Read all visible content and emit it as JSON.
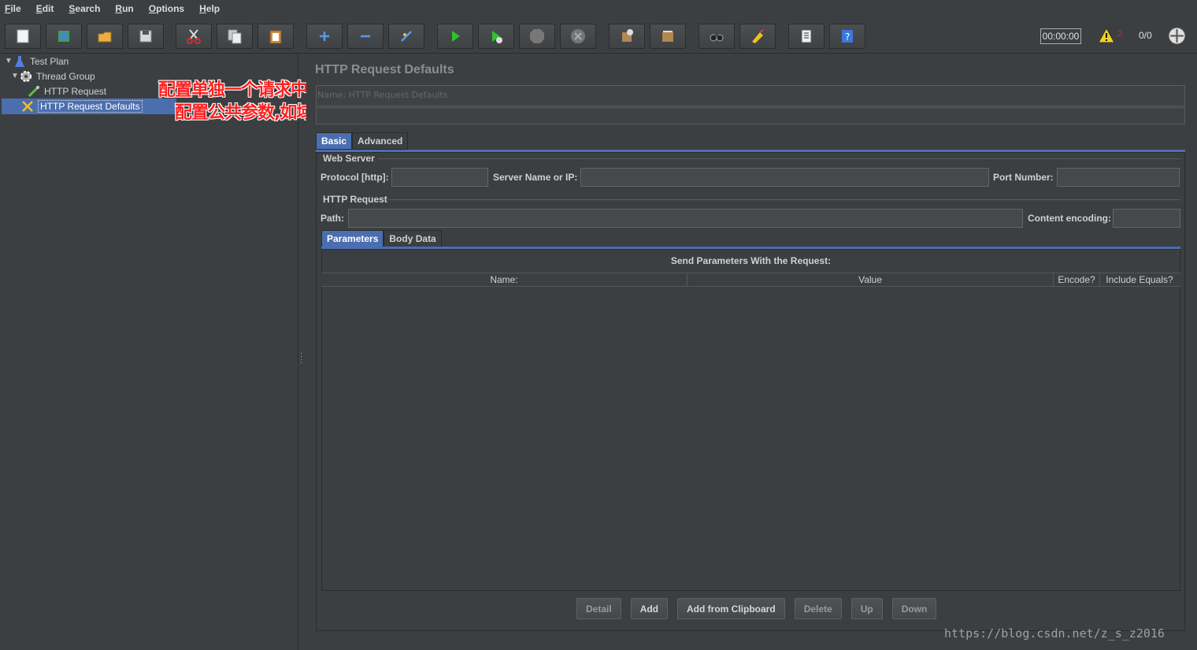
{
  "menu": [
    "File",
    "Edit",
    "Search",
    "Run",
    "Options",
    "Help"
  ],
  "toolbar": {
    "buttons": [
      {
        "name": "new-icon"
      },
      {
        "name": "templates-icon"
      },
      {
        "name": "open-icon"
      },
      {
        "name": "save-icon"
      },
      {
        "name": "cut-icon"
      },
      {
        "name": "copy-icon"
      },
      {
        "name": "paste-icon"
      },
      {
        "name": "expand-icon"
      },
      {
        "name": "collapse-icon"
      },
      {
        "name": "toggle-icon"
      },
      {
        "name": "start-icon"
      },
      {
        "name": "start-no-timers-icon"
      },
      {
        "name": "stop-icon"
      },
      {
        "name": "shutdown-icon"
      },
      {
        "name": "clear-icon"
      },
      {
        "name": "clear-all-icon"
      },
      {
        "name": "search-icon"
      },
      {
        "name": "reset-search-icon"
      },
      {
        "name": "function-helper-icon"
      },
      {
        "name": "help-icon"
      }
    ],
    "timer": "00:00:00",
    "error_count": "2",
    "threads": "0/0"
  },
  "tree": {
    "items": [
      {
        "label": "Test Plan"
      },
      {
        "label": "Thread Group"
      },
      {
        "label": "HTTP Request"
      },
      {
        "label": "HTTP Request Defaults"
      }
    ]
  },
  "annotations": {
    "line1": "配置单独一个请求中特有的请求参数",
    "line2": "配置公共参数,如域名,ip等"
  },
  "panel": {
    "title": "HTTP Request Defaults",
    "name_label": "Name:",
    "name_value": "HTTP Request Defaults",
    "tabs": [
      "Basic",
      "Advanced"
    ],
    "web_server": {
      "title": "Web Server",
      "protocol_label": "Protocol [http]:",
      "server_label": "Server Name or IP:",
      "port_label": "Port Number:"
    },
    "http_request": {
      "title": "HTTP Request",
      "path_label": "Path:",
      "encoding_label": "Content encoding:"
    },
    "subtabs": [
      "Parameters",
      "Body Data"
    ],
    "params_caption": "Send Parameters With the Request:",
    "columns": [
      "Name:",
      "Value",
      "Encode?",
      "Include Equals?"
    ],
    "buttons": [
      "Detail",
      "Add",
      "Add from Clipboard",
      "Delete",
      "Up",
      "Down"
    ]
  },
  "watermark": "https://blog.csdn.net/z_s_z2016",
  "colors": {
    "selection": "#4b6eaf",
    "annotation": "#ff2020",
    "background": "#3c3f41"
  }
}
